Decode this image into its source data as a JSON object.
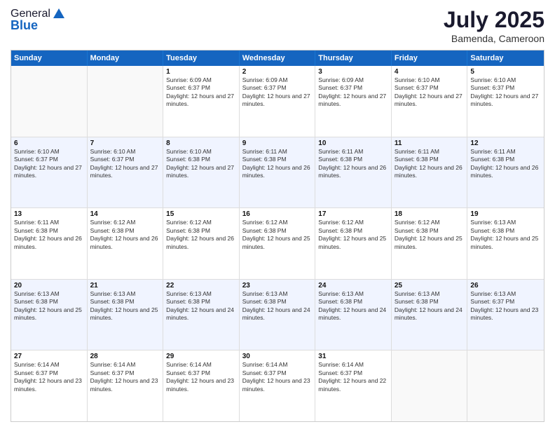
{
  "header": {
    "logo_general": "General",
    "logo_blue": "Blue",
    "month_year": "July 2025",
    "location": "Bamenda, Cameroon"
  },
  "weekdays": [
    "Sunday",
    "Monday",
    "Tuesday",
    "Wednesday",
    "Thursday",
    "Friday",
    "Saturday"
  ],
  "rows": [
    {
      "alt": false,
      "cells": [
        {
          "day": "",
          "info": ""
        },
        {
          "day": "",
          "info": ""
        },
        {
          "day": "1",
          "info": "Sunrise: 6:09 AM\nSunset: 6:37 PM\nDaylight: 12 hours and 27 minutes."
        },
        {
          "day": "2",
          "info": "Sunrise: 6:09 AM\nSunset: 6:37 PM\nDaylight: 12 hours and 27 minutes."
        },
        {
          "day": "3",
          "info": "Sunrise: 6:09 AM\nSunset: 6:37 PM\nDaylight: 12 hours and 27 minutes."
        },
        {
          "day": "4",
          "info": "Sunrise: 6:10 AM\nSunset: 6:37 PM\nDaylight: 12 hours and 27 minutes."
        },
        {
          "day": "5",
          "info": "Sunrise: 6:10 AM\nSunset: 6:37 PM\nDaylight: 12 hours and 27 minutes."
        }
      ]
    },
    {
      "alt": true,
      "cells": [
        {
          "day": "6",
          "info": "Sunrise: 6:10 AM\nSunset: 6:37 PM\nDaylight: 12 hours and 27 minutes."
        },
        {
          "day": "7",
          "info": "Sunrise: 6:10 AM\nSunset: 6:37 PM\nDaylight: 12 hours and 27 minutes."
        },
        {
          "day": "8",
          "info": "Sunrise: 6:10 AM\nSunset: 6:38 PM\nDaylight: 12 hours and 27 minutes."
        },
        {
          "day": "9",
          "info": "Sunrise: 6:11 AM\nSunset: 6:38 PM\nDaylight: 12 hours and 26 minutes."
        },
        {
          "day": "10",
          "info": "Sunrise: 6:11 AM\nSunset: 6:38 PM\nDaylight: 12 hours and 26 minutes."
        },
        {
          "day": "11",
          "info": "Sunrise: 6:11 AM\nSunset: 6:38 PM\nDaylight: 12 hours and 26 minutes."
        },
        {
          "day": "12",
          "info": "Sunrise: 6:11 AM\nSunset: 6:38 PM\nDaylight: 12 hours and 26 minutes."
        }
      ]
    },
    {
      "alt": false,
      "cells": [
        {
          "day": "13",
          "info": "Sunrise: 6:11 AM\nSunset: 6:38 PM\nDaylight: 12 hours and 26 minutes."
        },
        {
          "day": "14",
          "info": "Sunrise: 6:12 AM\nSunset: 6:38 PM\nDaylight: 12 hours and 26 minutes."
        },
        {
          "day": "15",
          "info": "Sunrise: 6:12 AM\nSunset: 6:38 PM\nDaylight: 12 hours and 26 minutes."
        },
        {
          "day": "16",
          "info": "Sunrise: 6:12 AM\nSunset: 6:38 PM\nDaylight: 12 hours and 25 minutes."
        },
        {
          "day": "17",
          "info": "Sunrise: 6:12 AM\nSunset: 6:38 PM\nDaylight: 12 hours and 25 minutes."
        },
        {
          "day": "18",
          "info": "Sunrise: 6:12 AM\nSunset: 6:38 PM\nDaylight: 12 hours and 25 minutes."
        },
        {
          "day": "19",
          "info": "Sunrise: 6:13 AM\nSunset: 6:38 PM\nDaylight: 12 hours and 25 minutes."
        }
      ]
    },
    {
      "alt": true,
      "cells": [
        {
          "day": "20",
          "info": "Sunrise: 6:13 AM\nSunset: 6:38 PM\nDaylight: 12 hours and 25 minutes."
        },
        {
          "day": "21",
          "info": "Sunrise: 6:13 AM\nSunset: 6:38 PM\nDaylight: 12 hours and 25 minutes."
        },
        {
          "day": "22",
          "info": "Sunrise: 6:13 AM\nSunset: 6:38 PM\nDaylight: 12 hours and 24 minutes."
        },
        {
          "day": "23",
          "info": "Sunrise: 6:13 AM\nSunset: 6:38 PM\nDaylight: 12 hours and 24 minutes."
        },
        {
          "day": "24",
          "info": "Sunrise: 6:13 AM\nSunset: 6:38 PM\nDaylight: 12 hours and 24 minutes."
        },
        {
          "day": "25",
          "info": "Sunrise: 6:13 AM\nSunset: 6:38 PM\nDaylight: 12 hours and 24 minutes."
        },
        {
          "day": "26",
          "info": "Sunrise: 6:13 AM\nSunset: 6:37 PM\nDaylight: 12 hours and 23 minutes."
        }
      ]
    },
    {
      "alt": false,
      "cells": [
        {
          "day": "27",
          "info": "Sunrise: 6:14 AM\nSunset: 6:37 PM\nDaylight: 12 hours and 23 minutes."
        },
        {
          "day": "28",
          "info": "Sunrise: 6:14 AM\nSunset: 6:37 PM\nDaylight: 12 hours and 23 minutes."
        },
        {
          "day": "29",
          "info": "Sunrise: 6:14 AM\nSunset: 6:37 PM\nDaylight: 12 hours and 23 minutes."
        },
        {
          "day": "30",
          "info": "Sunrise: 6:14 AM\nSunset: 6:37 PM\nDaylight: 12 hours and 23 minutes."
        },
        {
          "day": "31",
          "info": "Sunrise: 6:14 AM\nSunset: 6:37 PM\nDaylight: 12 hours and 22 minutes."
        },
        {
          "day": "",
          "info": ""
        },
        {
          "day": "",
          "info": ""
        }
      ]
    }
  ]
}
